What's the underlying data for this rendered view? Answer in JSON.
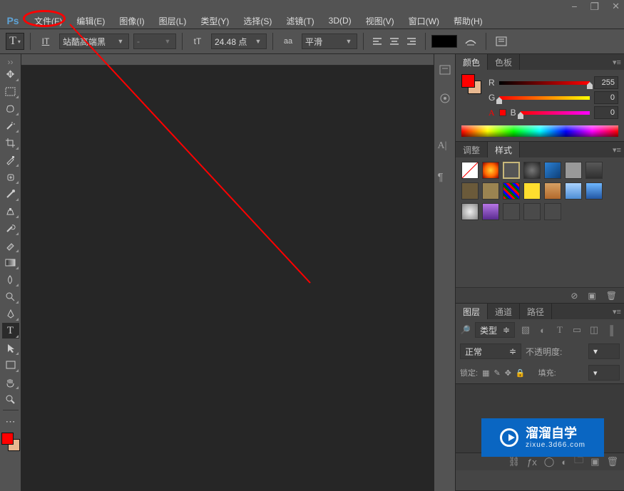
{
  "window": {
    "minimize": "−",
    "restore": "❐",
    "close": "✕"
  },
  "app": {
    "logo": "Ps"
  },
  "menu": {
    "file": "文件(F)",
    "edit": "编辑(E)",
    "image": "图像(I)",
    "layer": "图层(L)",
    "type": "类型(Y)",
    "select": "选择(S)",
    "filter": "滤镜(T)",
    "_3d": "3D(D)",
    "view": "视图(V)",
    "window": "窗口(W)",
    "help": "帮助(H)"
  },
  "options": {
    "tool_glyph": "T",
    "orient_glyph": "IT",
    "font_family": "站酷高端黑",
    "font_style": "-",
    "size_glyph": "tT",
    "size": "24.48 点",
    "aa_glyph": "aa",
    "aa": "平滑"
  },
  "panels": {
    "color": {
      "tab_color": "颜色",
      "tab_swatch": "色板",
      "r": {
        "label": "R",
        "value": "255"
      },
      "g": {
        "label": "G",
        "value": "0"
      },
      "b": {
        "label": "B",
        "value": "0"
      }
    },
    "styles": {
      "tab_adjust": "调整",
      "tab_styles": "样式"
    },
    "layers": {
      "tab_layers": "图层",
      "tab_channels": "通道",
      "tab_paths": "路径",
      "filter_label": "类型",
      "blend": "正常",
      "opacity_label": "不透明度:",
      "lock_label": "锁定:",
      "fill_label": "填充:"
    }
  },
  "watermark": {
    "l1": "溜溜自学",
    "l2": "zixue.3d66.com"
  }
}
